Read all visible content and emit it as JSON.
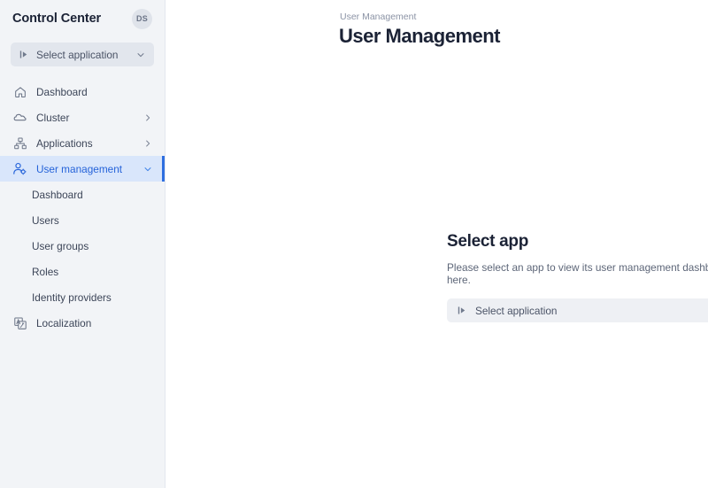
{
  "sidebar": {
    "brand": "Control Center",
    "avatar_initials": "DS",
    "app_select": {
      "label": "Select application",
      "leading_icon": "app-prompt-icon",
      "chevron_icon": "chevron-down-icon"
    },
    "nav": [
      {
        "label": "Dashboard",
        "icon": "home-icon",
        "chevron": "",
        "active": false
      },
      {
        "label": "Cluster",
        "icon": "cloud-icon",
        "chevron": "chevron-right-icon",
        "active": false
      },
      {
        "label": "Applications",
        "icon": "sitemap-icon",
        "chevron": "chevron-right-icon",
        "active": false
      },
      {
        "label": "User management",
        "icon": "user-gear-icon",
        "chevron": "chevron-down-icon",
        "active": true
      }
    ],
    "sub_items": [
      {
        "label": "Dashboard"
      },
      {
        "label": "Users"
      },
      {
        "label": "User groups"
      },
      {
        "label": "Roles"
      },
      {
        "label": "Identity providers"
      }
    ],
    "nav_bottom": [
      {
        "label": "Localization",
        "icon": "translate-icon",
        "chevron": "",
        "active": false
      }
    ]
  },
  "main": {
    "breadcrumb": "User Management",
    "title": "User Management",
    "empty_state": {
      "title": "Select app",
      "description": "Please select an app to view its user management dashboard here.",
      "select": {
        "label": "Select application",
        "leading_icon": "app-prompt-icon",
        "chevron_icon": "chevron-down-icon"
      }
    }
  },
  "colors": {
    "accent": "#2f6fe0",
    "active_bg": "#d9e6fb",
    "sidebar_bg": "#f2f4f7",
    "title": "#1b2235",
    "muted_text": "#8b93a5"
  }
}
